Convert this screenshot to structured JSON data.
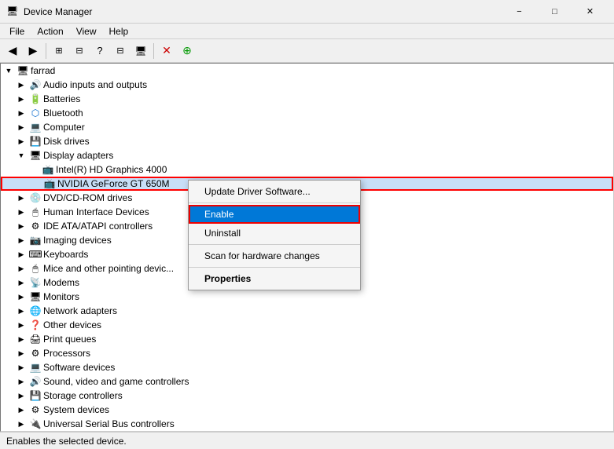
{
  "titleBar": {
    "icon": "🖥",
    "title": "Device Manager",
    "minimize": "−",
    "maximize": "□",
    "close": "✕"
  },
  "menuBar": {
    "items": [
      "File",
      "Action",
      "View",
      "Help"
    ]
  },
  "toolbar": {
    "buttons": [
      "◀",
      "▶",
      "⊞",
      "⊟",
      "?",
      "⊟",
      "🖥",
      "✕",
      "⊕"
    ]
  },
  "tree": {
    "rootUser": "farrad",
    "items": [
      {
        "label": "Audio inputs and outputs",
        "indent": 1,
        "expanded": false,
        "icon": "🔊"
      },
      {
        "label": "Batteries",
        "indent": 1,
        "expanded": false,
        "icon": "🔋"
      },
      {
        "label": "Bluetooth",
        "indent": 1,
        "expanded": false,
        "icon": "📶"
      },
      {
        "label": "Computer",
        "indent": 1,
        "expanded": false,
        "icon": "💻"
      },
      {
        "label": "Disk drives",
        "indent": 1,
        "expanded": false,
        "icon": "💾"
      },
      {
        "label": "Display adapters",
        "indent": 1,
        "expanded": true,
        "icon": "🖥"
      },
      {
        "label": "Intel(R) HD Graphics 4000",
        "indent": 2,
        "expanded": false,
        "icon": "📺"
      },
      {
        "label": "NVIDIA GeForce GT 650M",
        "indent": 2,
        "expanded": false,
        "icon": "📺",
        "selected": true
      },
      {
        "label": "DVD/CD-ROM drives",
        "indent": 1,
        "expanded": false,
        "icon": "💿"
      },
      {
        "label": "Human Interface Devices",
        "indent": 1,
        "expanded": false,
        "icon": "🖱"
      },
      {
        "label": "IDE ATA/ATAPI controllers",
        "indent": 1,
        "expanded": false,
        "icon": "⚙"
      },
      {
        "label": "Imaging devices",
        "indent": 1,
        "expanded": false,
        "icon": "📷"
      },
      {
        "label": "Keyboards",
        "indent": 1,
        "expanded": false,
        "icon": "⌨"
      },
      {
        "label": "Mice and other pointing devic...",
        "indent": 1,
        "expanded": false,
        "icon": "🖱"
      },
      {
        "label": "Modems",
        "indent": 1,
        "expanded": false,
        "icon": "📡"
      },
      {
        "label": "Monitors",
        "indent": 1,
        "expanded": false,
        "icon": "🖥"
      },
      {
        "label": "Network adapters",
        "indent": 1,
        "expanded": false,
        "icon": "🌐"
      },
      {
        "label": "Other devices",
        "indent": 1,
        "expanded": false,
        "icon": "❓"
      },
      {
        "label": "Print queues",
        "indent": 1,
        "expanded": false,
        "icon": "🖨"
      },
      {
        "label": "Processors",
        "indent": 1,
        "expanded": false,
        "icon": "⚙"
      },
      {
        "label": "Software devices",
        "indent": 1,
        "expanded": false,
        "icon": "💻"
      },
      {
        "label": "Sound, video and game controllers",
        "indent": 1,
        "expanded": false,
        "icon": "🔊"
      },
      {
        "label": "Storage controllers",
        "indent": 1,
        "expanded": false,
        "icon": "💾"
      },
      {
        "label": "System devices",
        "indent": 1,
        "expanded": false,
        "icon": "⚙"
      },
      {
        "label": "Universal Serial Bus controllers",
        "indent": 1,
        "expanded": false,
        "icon": "🔌"
      }
    ]
  },
  "contextMenu": {
    "items": [
      {
        "label": "Update Driver Software...",
        "type": "normal"
      },
      {
        "label": "separator",
        "type": "separator"
      },
      {
        "label": "Enable",
        "type": "highlighted"
      },
      {
        "label": "Uninstall",
        "type": "normal"
      },
      {
        "label": "separator",
        "type": "separator"
      },
      {
        "label": "Scan for hardware changes",
        "type": "normal"
      },
      {
        "label": "separator",
        "type": "separator"
      },
      {
        "label": "Properties",
        "type": "bold"
      }
    ]
  },
  "statusBar": {
    "text": "Enables the selected device."
  }
}
